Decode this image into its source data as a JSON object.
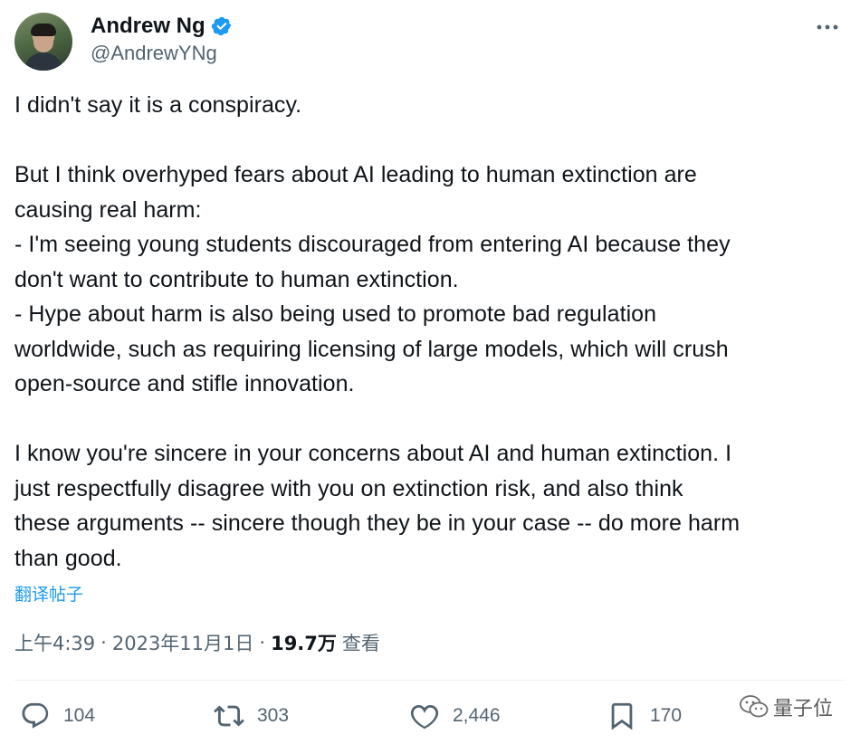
{
  "author": {
    "name": "Andrew Ng",
    "handle": "@AndrewYNg",
    "verified": true
  },
  "tweet": {
    "text": "I didn't say it is a conspiracy.\n\nBut I think overhyped fears about AI leading to human extinction are\ncausing real harm:\n- I'm seeing young students discouraged from entering AI because they\ndon't want to contribute to human extinction.\n- Hype about harm is also being used to promote bad regulation\nworldwide, such as requiring licensing of large models, which will crush\nopen-source and stifle innovation.\n\nI know you're sincere in your concerns about AI and human extinction. I\njust respectfully disagree with you on extinction risk, and also think\nthese arguments -- sincere though they be in your case -- do more harm\nthan good.",
    "translate_label": "翻译帖子"
  },
  "meta": {
    "time": "上午4:39",
    "separator": "·",
    "date": "2023年11月1日",
    "views_count": "19.7万",
    "views_label": "查看"
  },
  "actions": {
    "replies": "104",
    "retweets": "303",
    "likes": "2,446",
    "bookmarks": "170"
  },
  "watermark": {
    "text": "量子位"
  },
  "icons": {
    "verified": "verified-badge-icon",
    "more": "more-icon",
    "reply": "reply-icon",
    "retweet": "retweet-icon",
    "like": "heart-icon",
    "bookmark": "bookmark-icon",
    "watermark": "wechat-icon"
  },
  "colors": {
    "accent": "#1d9bf0",
    "text": "#0f1419",
    "secondary": "#536471"
  }
}
